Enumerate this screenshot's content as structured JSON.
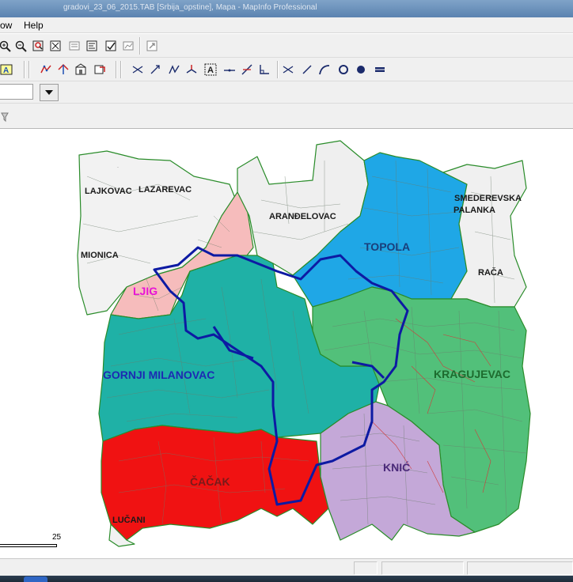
{
  "window": {
    "title": "gradovi_23_06_2015.TAB [Srbija_opstine], Mapa - MapInfo Professional"
  },
  "menu": {
    "items": [
      "ow",
      "Help"
    ]
  },
  "colors": {
    "lazarevac_lajkovac": "#f2f2f2",
    "ljig": "#f6bcbc",
    "gornji_milanovac": "#1fb1a6",
    "cacak": "#f01212",
    "arandjelovac": "#efefef",
    "topola": "#1fa7e6",
    "kragujevac": "#52c07a",
    "knic": "#c4a8d8",
    "smederevska_palanka": "#f0f0f0",
    "border": "#2a8c2a",
    "selection": "#0d1aa3"
  },
  "icons": {
    "toolbar1": [
      "zoom-in-icon",
      "zoom-out-icon",
      "change-view-icon",
      "grabber-icon",
      "info-icon",
      "ruler-icon",
      "legend-icon",
      "statistics-icon",
      "hotlink-icon"
    ],
    "toolbar2": [
      "label-icon",
      "drag-map-icon",
      "clip-region-icon",
      "layer-control-icon",
      "statistics-icon",
      "intersection-icon",
      "arrow-icon",
      "reshape-icon",
      "add-node-icon",
      "text-icon",
      "line-style-icon",
      "split-icon",
      "angle-icon",
      "symbol-icon",
      "line-icon",
      "polyline-icon",
      "arc-icon",
      "ellipse-icon",
      "circle-icon",
      "frame-icon"
    ],
    "toolbar4": [
      "select-tool-icon"
    ]
  },
  "map": {
    "labels": {
      "lajkovac": "LAJKOVAC",
      "lazarevac": "LAZAREVAC",
      "mionica": "MIONICA",
      "ljig": "LJIG",
      "gornji_milanovac": "GORNJI MILANOVAC",
      "cacak": "ČAČAK",
      "lucani": "LUČANI",
      "arandjelovac": "ARANĐELOVAC",
      "topola": "TOPOLA",
      "smederevska_palanka_1": "SMEDEREVSKA",
      "smederevska_palanka_2": "PALANKA",
      "raca": "RAČA",
      "kragujevac": "KRAGUJEVAC",
      "knic": "KNIĆ"
    },
    "label_colors": {
      "lajkovac": "#1a1a1a",
      "ljig": "#e812d6",
      "gornji_milanovac": "#1c2ab3",
      "cacak": "#7a1a1a",
      "topola": "#1a3e7a",
      "kragujevac": "#1d6b2e",
      "knic": "#4b2a7a"
    }
  },
  "scale": {
    "label": "25"
  }
}
